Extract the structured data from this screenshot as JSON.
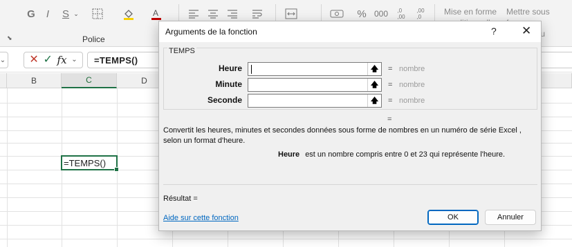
{
  "ribbon": {
    "font_buttons": [
      "G",
      "I",
      "S"
    ],
    "font_group_label": "Police",
    "percent_symbol": "%",
    "thousands_symbol": "000",
    "decimal_inc": ",0\n,00",
    "decimal_dec": ",00\n,0",
    "cond_format_label": "Mise en forme",
    "cond_format_sub": "conditionnelle",
    "table_format_label": "Mettre sous forme",
    "table_format_sub": "de tableau"
  },
  "formula_bar": {
    "fx": "fx",
    "formula": "=TEMPS()"
  },
  "grid": {
    "columns": [
      "B",
      "C",
      "D"
    ],
    "active_column": "C",
    "active_cell_value": "=TEMPS()"
  },
  "dialog": {
    "title": "Arguments de la fonction",
    "help_glyph": "?",
    "close_glyph": "✕",
    "function_name": "TEMPS",
    "arguments": [
      {
        "label": "Heure",
        "value": "",
        "result": "nombre"
      },
      {
        "label": "Minute",
        "value": "",
        "result": "nombre"
      },
      {
        "label": "Seconde",
        "value": "",
        "result": "nombre"
      }
    ],
    "equals": "=",
    "description": "Convertit les heures, minutes et secondes données sous forme de nombres en un numéro de série Excel , selon un format d'heure.",
    "arg_help_name": "Heure",
    "arg_help_text": "est un nombre compris entre 0 et 23 qui représente l'heure.",
    "result_label": "Résultat =",
    "help_link": "Aide sur cette fonction",
    "ok_label": "OK",
    "cancel_label": "Annuler"
  },
  "colors": {
    "excel_green": "#1e7145",
    "link_blue": "#0067c0",
    "ok_border": "#0067c0"
  }
}
